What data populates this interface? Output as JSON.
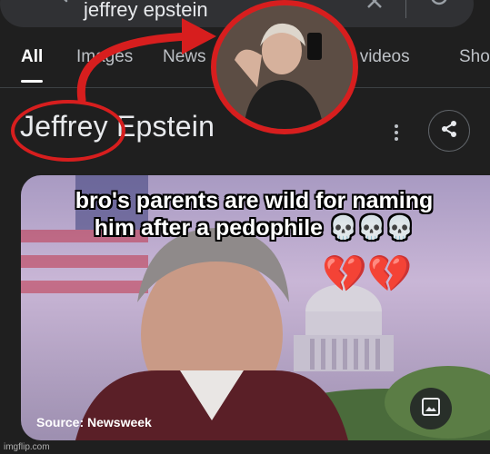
{
  "search": {
    "query": "jeffrey epstein"
  },
  "tabs": [
    {
      "label": "All",
      "active": true
    },
    {
      "label": "Images",
      "active": false
    },
    {
      "label": "News",
      "active": false
    },
    {
      "label": "Short videos",
      "active": false
    },
    {
      "label": "Sho",
      "active": false
    }
  ],
  "entity": {
    "title": "Jeffrey Epstein"
  },
  "image_card": {
    "source": "Source: Newsweek"
  },
  "meme": {
    "caption_line1": "bro's parents are wild for naming",
    "caption_line2": "him after a pedophile 💀💀💀",
    "hearts": "💔💔"
  },
  "footer": {
    "watermark": "imgflip.com"
  },
  "colors": {
    "annotation_red": "#d71e1e",
    "background": "#1f1f1f",
    "searchbar": "#303134"
  }
}
